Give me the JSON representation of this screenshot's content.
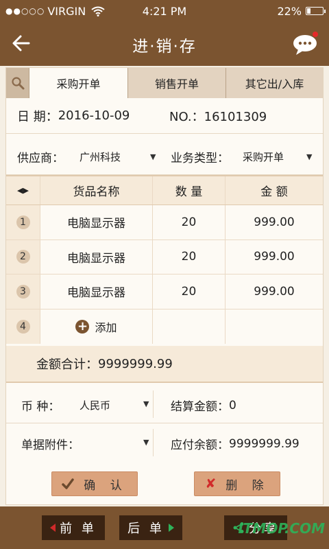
{
  "statusbar": {
    "signal": "●●○○○",
    "carrier": "VIRGIN",
    "time": "4:21 PM",
    "battery": "22%",
    "battery_level": 0.22,
    "icons": [
      "wifi-icon",
      "battery-icon"
    ]
  },
  "navbar": {
    "title": "进·销·存",
    "icons": [
      "back-arrow-icon",
      "chat-bubble-icon"
    ]
  },
  "tabs": [
    {
      "label": "采购开单",
      "active": true
    },
    {
      "label": "销售开单",
      "active": false
    },
    {
      "label": "其它出/入库",
      "active": false
    }
  ],
  "form": {
    "date_label": "日 期：",
    "date_value": "2016-10-09",
    "no_label": "NO.：",
    "no_value": "16101309",
    "supplier_label": "供应商：",
    "supplier_value": "广州科技",
    "biztype_label": "业务类型：",
    "biztype_value": "采购开单"
  },
  "table": {
    "headers": [
      "货品名称",
      "数 量",
      "金 额"
    ],
    "rows": [
      {
        "index": "1",
        "name": "电脑显示器",
        "qty": "20",
        "amount": "999.00"
      },
      {
        "index": "2",
        "name": "电脑显示器",
        "qty": "20",
        "amount": "999.00"
      },
      {
        "index": "3",
        "name": "电脑显示器",
        "qty": "20",
        "amount": "999.00"
      }
    ],
    "add_index": "4",
    "add_label": "添加"
  },
  "summary": {
    "total_label": "金额合计：",
    "total_value": "9999999.99",
    "currency_label": "币 种：",
    "currency_value": "人民币",
    "settle_label": "结算金额：",
    "settle_value": "0",
    "attach_label": "单据附件：",
    "payable_label": "应付余额：",
    "payable_value": "9999999.99"
  },
  "actions": {
    "confirm": "确 认",
    "delete": "删 除"
  },
  "bottom": {
    "prev": "前 单",
    "next": "后 单",
    "share": "分享",
    "watermark": "ITMOP.COM"
  },
  "colors": {
    "brand": "#7b5430",
    "button": "#dba37d",
    "dark_button": "#3a2312"
  }
}
